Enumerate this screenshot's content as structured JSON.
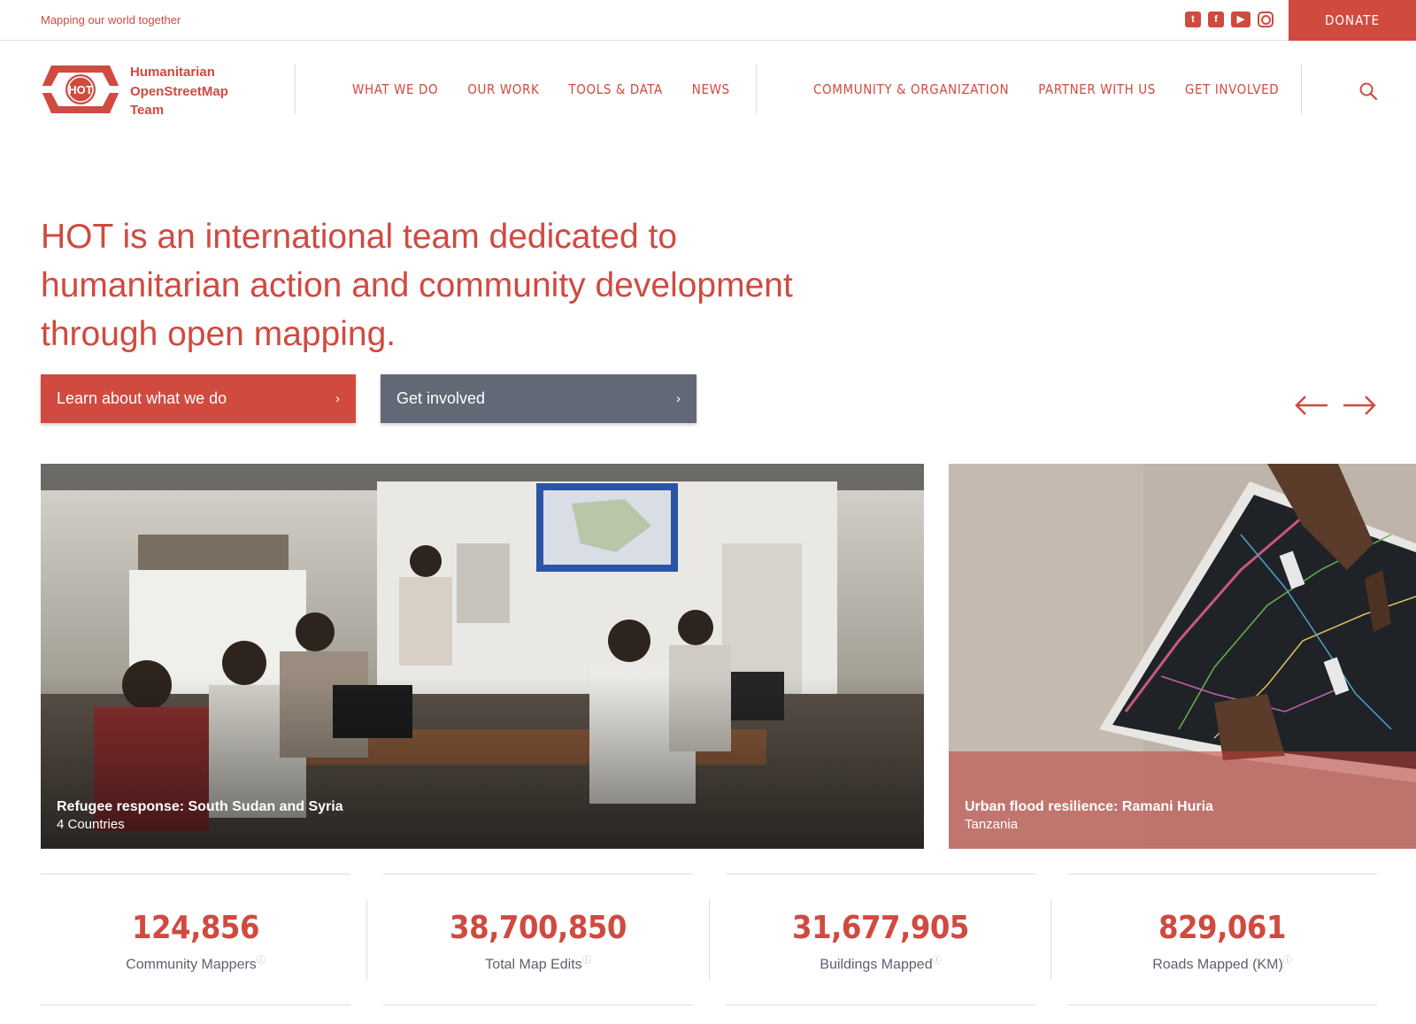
{
  "topbar": {
    "tagline": "Mapping our world together",
    "social": [
      "twitter-icon",
      "facebook-icon",
      "youtube-icon",
      "instagram-icon"
    ],
    "donate": "DONATE"
  },
  "header": {
    "logo_text": "HOT",
    "org_name": [
      "Humanitarian",
      "OpenStreetMap",
      "Team"
    ],
    "nav_left": [
      "WHAT WE DO",
      "OUR WORK",
      "TOOLS & DATA",
      "NEWS"
    ],
    "nav_right": [
      "COMMUNITY & ORGANIZATION",
      "PARTNER WITH US",
      "GET INVOLVED"
    ]
  },
  "hero": {
    "headline": "HOT is an international team dedicated to humanitarian action and community development through open mapping.",
    "primary_button": "Learn about what we do",
    "secondary_button": "Get involved"
  },
  "cards": [
    {
      "title": "Refugee response: South Sudan and Syria",
      "subtitle": "4 Countries"
    },
    {
      "title": "Urban flood resilience: Ramani Huria",
      "subtitle": "Tanzania"
    }
  ],
  "stats": [
    {
      "value": "124,856",
      "label": "Community Mappers"
    },
    {
      "value": "38,700,850",
      "label": "Total Map Edits"
    },
    {
      "value": "31,677,905",
      "label": "Buildings Mapped"
    },
    {
      "value": "829,061",
      "label": "Roads Mapped (KM)"
    }
  ],
  "colors": {
    "brand_red": "#d04a40",
    "button_gray": "#626876",
    "stat_label": "#5c6170"
  }
}
